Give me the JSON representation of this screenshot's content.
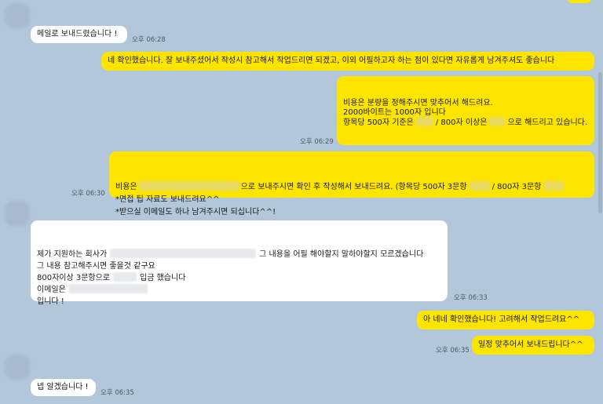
{
  "messages": [
    {
      "side": "in",
      "text": "메일로 보내드렸습니다 !",
      "time": "오후 06:28"
    },
    {
      "side": "out",
      "text": "네 확인했습니다. 잘 보내주셨어서 작성시 참고해서 작업드리면 되겠고, 이외 어필하고자 하는 점이 있다면 자유롭게 남겨주셔도 좋습니다"
    },
    {
      "side": "out",
      "lines": [
        "비용은 분량을 정해주시면 맞추어서 해드려요.",
        "",
        "2000바이트는 1000자 입니다",
        "",
        "항목당 500자 기준은",
        "/ 800자 이상은",
        "으로 해드리고 있습니다."
      ],
      "time": "오후 06:29"
    },
    {
      "side": "out",
      "lines": [
        "비용은",
        "으로 보내주시면 확인 후 작성해서 보내드려요. (항목당 500자 3문항",
        "/ 800자 3문항",
        "*면접 팁 자료도 보내드려요^^",
        "*받으실 이메일도 하나 남겨주시면 되십니다^^!"
      ],
      "time": "오후 06:30"
    },
    {
      "side": "in",
      "lines": [
        "제가 지원하는 회사가",
        "그 내용을 어필 해야할지 말하야할지 모르겠습니다",
        "그 내용 참고해주시면 좋을것 같구요",
        "",
        "800자이상 3문항으로",
        "입금 했습니다",
        "이메일은",
        "입니다 !"
      ],
      "time": "오후 06:33"
    },
    {
      "side": "out",
      "text": "아 네네 확인했습니다! 고려해서 작업드려요^^"
    },
    {
      "side": "out",
      "text": "일정 맞추어서 보내드립니다^^",
      "time": "오후 06:35"
    },
    {
      "side": "in",
      "text": "넵 알겠습니다 !",
      "time": "오후 06:35"
    }
  ]
}
